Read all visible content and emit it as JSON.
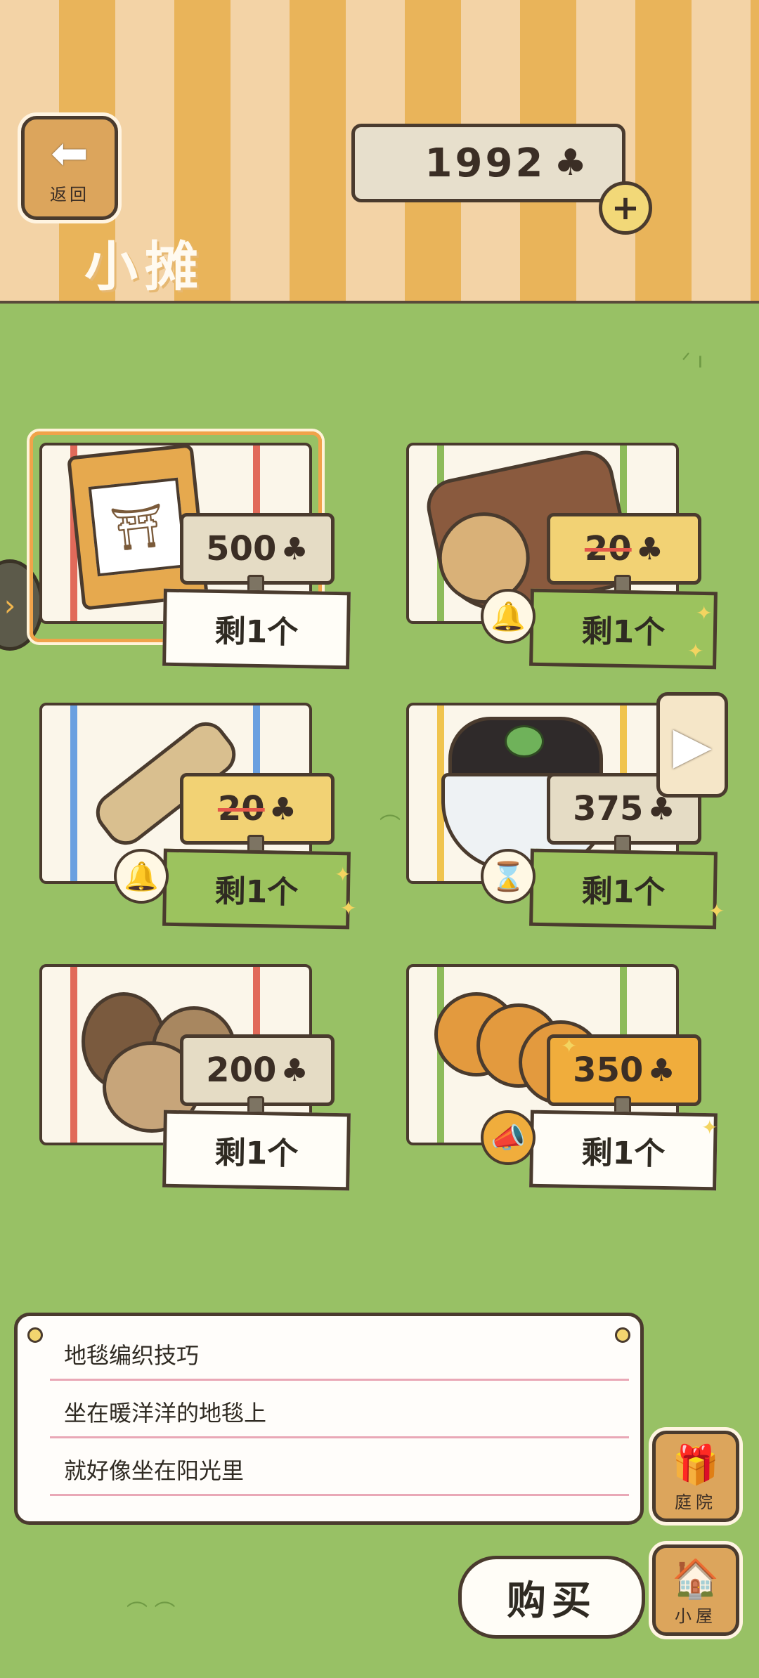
{
  "header": {
    "back_label": "返回",
    "back_icon": "arrow-left-icon",
    "currency_amount": "1992",
    "currency_icon": "clover-icon",
    "add_icon": "plus-icon",
    "title": "小摊"
  },
  "items": [
    {
      "name": "地毯编织技巧",
      "price": "500",
      "stock": "剩1个",
      "art": "book-icon",
      "sale": false
    },
    {
      "name": "木头",
      "price": "20",
      "stock": "剩1个",
      "art": "log-icon",
      "sale": true,
      "badge": "bell-icon"
    },
    {
      "name": "稻草",
      "price": "20",
      "stock": "剩1个",
      "art": "straw-icon",
      "sale": true,
      "badge": "bell-icon"
    },
    {
      "name": "凉粉",
      "price": "375",
      "stock": "剩1个",
      "art": "jelly-dessert-icon",
      "sale": false,
      "badge": "hourglass-icon"
    },
    {
      "name": "坚果",
      "price": "200",
      "stock": "剩1个",
      "art": "nuts-icon",
      "sale": false
    },
    {
      "name": "煎饼",
      "price": "350",
      "stock": "剩1个",
      "art": "pancakes-icon",
      "sale": false,
      "badge": "megaphone-icon"
    }
  ],
  "description": {
    "lines": [
      "地毯编织技巧",
      "坐在暖洋洋的地毯上",
      "就好像坐在阳光里"
    ]
  },
  "side_buttons": {
    "yard_label": "庭院",
    "house_label": "小屋"
  },
  "buy_label": "购买",
  "colors": {
    "grass": "#98c165",
    "stripe_light": "#f3d3a6",
    "stripe_dark": "#e9b45a",
    "outline": "#4a3b2e"
  }
}
